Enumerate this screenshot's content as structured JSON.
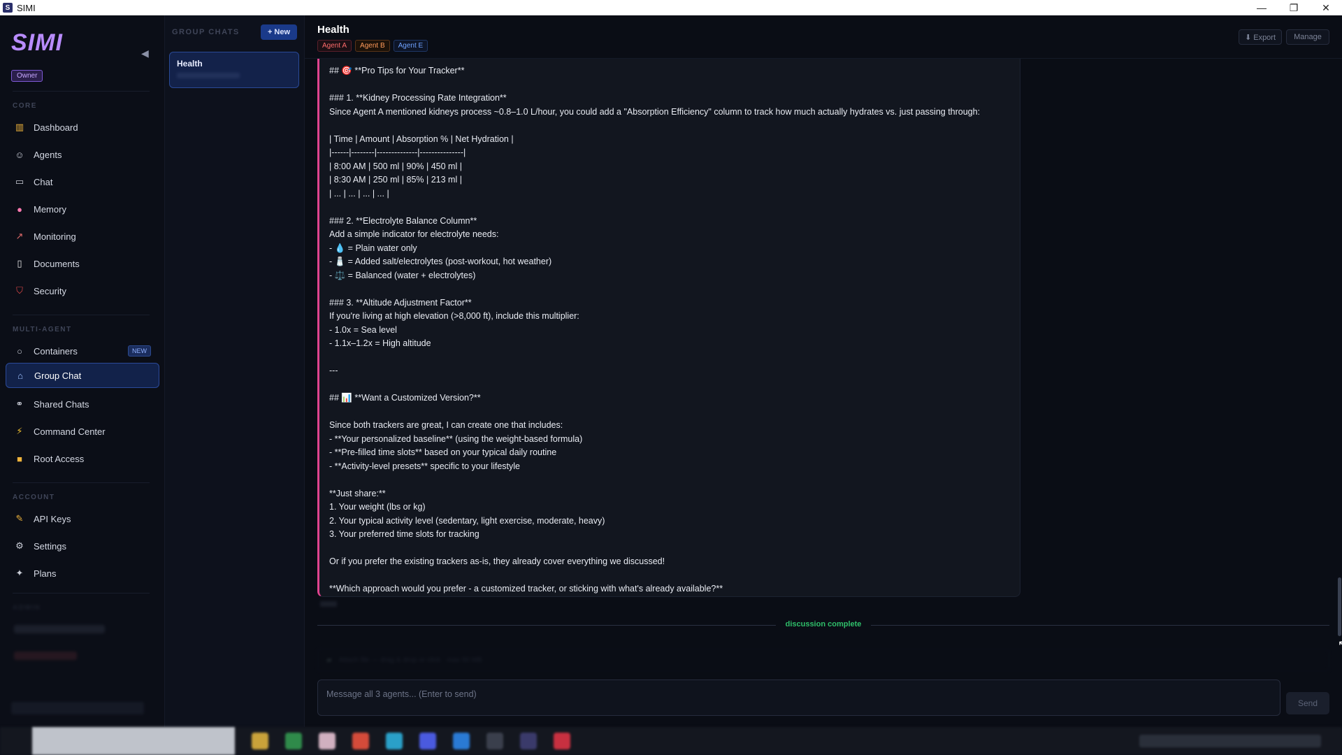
{
  "window": {
    "title": "SIMI",
    "controls": [
      "—",
      "❐",
      "✕"
    ]
  },
  "sidebar": {
    "logo": "SIMI",
    "role_badge": "Owner",
    "sections": {
      "core": "CORE",
      "multi_agent": "MULTI-AGENT",
      "account": "ACCOUNT",
      "admin": "ADMIN"
    },
    "core_items": [
      {
        "label": "Dashboard",
        "icon": "chart-icon"
      },
      {
        "label": "Agents",
        "icon": "robot-icon"
      },
      {
        "label": "Chat",
        "icon": "chat-icon"
      },
      {
        "label": "Memory",
        "icon": "brain-icon"
      },
      {
        "label": "Monitoring",
        "icon": "trend-icon"
      },
      {
        "label": "Documents",
        "icon": "document-icon"
      },
      {
        "label": "Security",
        "icon": "shield-icon"
      }
    ],
    "multi_items": [
      {
        "label": "Containers",
        "icon": "circle-icon",
        "badge": "NEW"
      },
      {
        "label": "Group Chat",
        "icon": "home-icon",
        "active": true
      },
      {
        "label": "Shared Chats",
        "icon": "link-icon"
      },
      {
        "label": "Command Center",
        "icon": "lightning-icon"
      },
      {
        "label": "Root Access",
        "icon": "lock-icon"
      }
    ],
    "account_items": [
      {
        "label": "API Keys",
        "icon": "wrench-icon"
      },
      {
        "label": "Settings",
        "icon": "gear-icon"
      },
      {
        "label": "Plans",
        "icon": "sparkle-icon"
      }
    ]
  },
  "group_chats": {
    "title": "GROUP CHATS",
    "new_button": "+ New",
    "items": [
      {
        "title": "Health"
      }
    ]
  },
  "main": {
    "title": "Health",
    "agents": [
      "Agent A",
      "Agent B",
      "Agent E"
    ],
    "export_label": "⬇ Export",
    "manage_label": "Manage",
    "message_lines": [
      "## 🎯 **Pro Tips for Your Tracker**",
      "",
      "### 1. **Kidney Processing Rate Integration**",
      "Since Agent A mentioned kidneys process ~0.8–1.0 L/hour, you could add a \"Absorption Efficiency\" column to track how much actually hydrates vs. just passing through:",
      "",
      "| Time | Amount | Absorption % | Net Hydration |",
      "|------|--------|--------------|---------------|",
      "| 8:00 AM | 500 ml | 90% | 450 ml |",
      "| 8:30 AM | 250 ml | 85% | 213 ml |",
      "| ... | ... | ... | ... |",
      "",
      "### 2. **Electrolyte Balance Column**",
      "Add a simple indicator for electrolyte needs:",
      "- 💧 = Plain water only",
      "- 🧂 = Added salt/electrolytes (post-workout, hot weather)",
      "- ⚖️ = Balanced (water + electrolytes)",
      "",
      "### 3. **Altitude Adjustment Factor**",
      "If you're living at high elevation (>8,000 ft), include this multiplier:",
      "- 1.0x = Sea level",
      "- 1.1x–1.2x = High altitude",
      "",
      "---",
      "",
      "## 📊 **Want a Customized Version?**",
      "",
      "Since both trackers are great, I can create one that includes:",
      "- **Your personalized baseline** (using the weight-based formula)",
      "- **Pre-filled time slots** based on your typical daily routine",
      "- **Activity-level presets** specific to your lifestyle",
      "",
      "**Just share:**",
      "1. Your weight (lbs or kg)",
      "2. Your typical activity level (sedentary, light exercise, moderate, heavy)",
      "3. Your preferred time slots for tracking",
      "",
      "Or if you prefer the existing trackers as-is, they already cover everything we discussed!",
      "",
      "**Which approach would you prefer - a customized tracker, or sticking with what's already available?**"
    ],
    "status_label": "discussion complete",
    "attach_placeholder": "Attach file — drag & drop or click · max 50 MB",
    "input_placeholder": "Message all 3 agents... (Enter to send)",
    "send_label": "Send"
  },
  "colors": {
    "accent_pink": "#e0438e",
    "status_green": "#2fbf6a",
    "logo_purple": "#b98cff",
    "active_blue": "#2b4a9a"
  }
}
